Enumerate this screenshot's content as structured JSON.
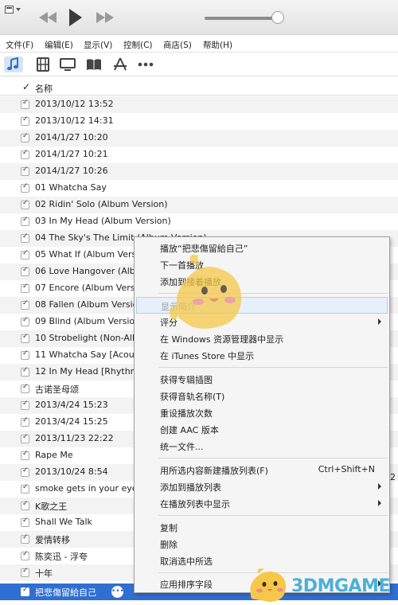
{
  "menubar": [
    {
      "label": "文件(F)"
    },
    {
      "label": "编辑(E)"
    },
    {
      "label": "显示(V)"
    },
    {
      "label": "控制(C)"
    },
    {
      "label": "商店(S)"
    },
    {
      "label": "帮助(H)"
    }
  ],
  "media_tabs": [
    "music-icon",
    "film-icon",
    "tv-icon",
    "book-icon",
    "appstore-icon",
    "more-icon"
  ],
  "list": {
    "check_header": "✓",
    "name_header": "名称",
    "rows": [
      "2013/10/12 13:52",
      "2013/10/12 14:31",
      "2014/1/27 10:20",
      "2014/1/27 10:21",
      "2014/1/27 10:26",
      "01 Whatcha Say",
      "02 Ridin' Solo (Album Version)",
      "03 In My Head (Album Version)",
      "04 The Sky's The Limit (Album Version)",
      "05 What If (Album Version)",
      "06 Love Hangover (Album Version)",
      "07 Encore (Album Version)",
      "08 Fallen (Album Version)",
      "09 Blind (Album Version)",
      "10 Strobelight (Non-Album Track)",
      "11 Whatcha Say [Acoustic]",
      "12 In My Head [Rhythm]",
      "古诺圣母颂",
      "2013/4/24 15:23",
      "2013/4/24 15:25",
      "2013/11/23 22:22",
      "Rape Me",
      "2013/10/24 8:54",
      "smoke gets in your eyes",
      "K歌之王",
      "Shall We Talk",
      "爱情转移",
      "陈奕迅 - 浮夸",
      "十年",
      "把悲傷留給自己"
    ],
    "side_value": "2"
  },
  "context_menu": [
    {
      "label": "播放“把悲傷留給自己”",
      "type": "item"
    },
    {
      "label": "下一首播放",
      "type": "item"
    },
    {
      "label": "添加到接着播放",
      "type": "item"
    },
    {
      "type": "sep"
    },
    {
      "label": "显示简介",
      "type": "item",
      "state": "disabled highlight"
    },
    {
      "label": "评分",
      "type": "item",
      "submenu": true
    },
    {
      "label": "在 Windows 资源管理器中显示",
      "type": "item"
    },
    {
      "label": "在 iTunes Store 中显示",
      "type": "item"
    },
    {
      "type": "sep"
    },
    {
      "label": "获得专辑插图",
      "type": "item"
    },
    {
      "label": "获得音轨名称(T)",
      "type": "item"
    },
    {
      "label": "重设播放次数",
      "type": "item"
    },
    {
      "label": "创建 AAC 版本",
      "type": "item"
    },
    {
      "label": "统一文件...",
      "type": "item"
    },
    {
      "type": "sep"
    },
    {
      "label": "用所选内容新建播放列表(F)",
      "shortcut": "Ctrl+Shift+N",
      "type": "item"
    },
    {
      "label": "添加到播放列表",
      "type": "item",
      "submenu": true
    },
    {
      "label": "在播放列表中显示",
      "type": "item",
      "submenu": true
    },
    {
      "type": "sep"
    },
    {
      "label": "复制",
      "type": "item"
    },
    {
      "label": "删除",
      "type": "item"
    },
    {
      "label": "取消选中所选",
      "type": "item"
    },
    {
      "type": "sep"
    },
    {
      "label": "应用排序字段",
      "type": "item",
      "submenu": true
    }
  ],
  "watermark": "3DMGAME",
  "colors": {
    "selection": "#2f6fd1",
    "accent": "#4ab0d9",
    "mascot": "#f6c84a"
  }
}
